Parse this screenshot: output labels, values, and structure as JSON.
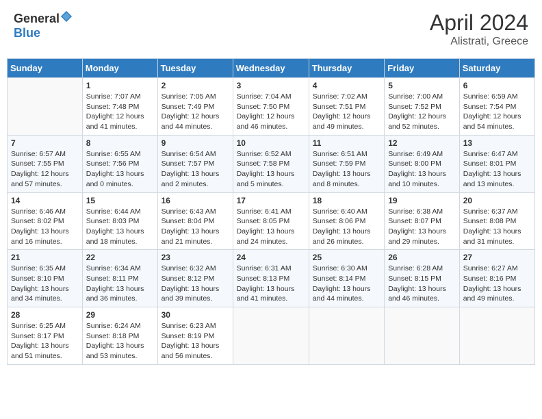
{
  "header": {
    "logo_general": "General",
    "logo_blue": "Blue",
    "month": "April 2024",
    "location": "Alistrati, Greece"
  },
  "days_of_week": [
    "Sunday",
    "Monday",
    "Tuesday",
    "Wednesday",
    "Thursday",
    "Friday",
    "Saturday"
  ],
  "weeks": [
    [
      {
        "day": "",
        "info": ""
      },
      {
        "day": "1",
        "info": "Sunrise: 7:07 AM\nSunset: 7:48 PM\nDaylight: 12 hours\nand 41 minutes."
      },
      {
        "day": "2",
        "info": "Sunrise: 7:05 AM\nSunset: 7:49 PM\nDaylight: 12 hours\nand 44 minutes."
      },
      {
        "day": "3",
        "info": "Sunrise: 7:04 AM\nSunset: 7:50 PM\nDaylight: 12 hours\nand 46 minutes."
      },
      {
        "day": "4",
        "info": "Sunrise: 7:02 AM\nSunset: 7:51 PM\nDaylight: 12 hours\nand 49 minutes."
      },
      {
        "day": "5",
        "info": "Sunrise: 7:00 AM\nSunset: 7:52 PM\nDaylight: 12 hours\nand 52 minutes."
      },
      {
        "day": "6",
        "info": "Sunrise: 6:59 AM\nSunset: 7:54 PM\nDaylight: 12 hours\nand 54 minutes."
      }
    ],
    [
      {
        "day": "7",
        "info": "Sunrise: 6:57 AM\nSunset: 7:55 PM\nDaylight: 12 hours\nand 57 minutes."
      },
      {
        "day": "8",
        "info": "Sunrise: 6:55 AM\nSunset: 7:56 PM\nDaylight: 13 hours\nand 0 minutes."
      },
      {
        "day": "9",
        "info": "Sunrise: 6:54 AM\nSunset: 7:57 PM\nDaylight: 13 hours\nand 2 minutes."
      },
      {
        "day": "10",
        "info": "Sunrise: 6:52 AM\nSunset: 7:58 PM\nDaylight: 13 hours\nand 5 minutes."
      },
      {
        "day": "11",
        "info": "Sunrise: 6:51 AM\nSunset: 7:59 PM\nDaylight: 13 hours\nand 8 minutes."
      },
      {
        "day": "12",
        "info": "Sunrise: 6:49 AM\nSunset: 8:00 PM\nDaylight: 13 hours\nand 10 minutes."
      },
      {
        "day": "13",
        "info": "Sunrise: 6:47 AM\nSunset: 8:01 PM\nDaylight: 13 hours\nand 13 minutes."
      }
    ],
    [
      {
        "day": "14",
        "info": "Sunrise: 6:46 AM\nSunset: 8:02 PM\nDaylight: 13 hours\nand 16 minutes."
      },
      {
        "day": "15",
        "info": "Sunrise: 6:44 AM\nSunset: 8:03 PM\nDaylight: 13 hours\nand 18 minutes."
      },
      {
        "day": "16",
        "info": "Sunrise: 6:43 AM\nSunset: 8:04 PM\nDaylight: 13 hours\nand 21 minutes."
      },
      {
        "day": "17",
        "info": "Sunrise: 6:41 AM\nSunset: 8:05 PM\nDaylight: 13 hours\nand 24 minutes."
      },
      {
        "day": "18",
        "info": "Sunrise: 6:40 AM\nSunset: 8:06 PM\nDaylight: 13 hours\nand 26 minutes."
      },
      {
        "day": "19",
        "info": "Sunrise: 6:38 AM\nSunset: 8:07 PM\nDaylight: 13 hours\nand 29 minutes."
      },
      {
        "day": "20",
        "info": "Sunrise: 6:37 AM\nSunset: 8:08 PM\nDaylight: 13 hours\nand 31 minutes."
      }
    ],
    [
      {
        "day": "21",
        "info": "Sunrise: 6:35 AM\nSunset: 8:10 PM\nDaylight: 13 hours\nand 34 minutes."
      },
      {
        "day": "22",
        "info": "Sunrise: 6:34 AM\nSunset: 8:11 PM\nDaylight: 13 hours\nand 36 minutes."
      },
      {
        "day": "23",
        "info": "Sunrise: 6:32 AM\nSunset: 8:12 PM\nDaylight: 13 hours\nand 39 minutes."
      },
      {
        "day": "24",
        "info": "Sunrise: 6:31 AM\nSunset: 8:13 PM\nDaylight: 13 hours\nand 41 minutes."
      },
      {
        "day": "25",
        "info": "Sunrise: 6:30 AM\nSunset: 8:14 PM\nDaylight: 13 hours\nand 44 minutes."
      },
      {
        "day": "26",
        "info": "Sunrise: 6:28 AM\nSunset: 8:15 PM\nDaylight: 13 hours\nand 46 minutes."
      },
      {
        "day": "27",
        "info": "Sunrise: 6:27 AM\nSunset: 8:16 PM\nDaylight: 13 hours\nand 49 minutes."
      }
    ],
    [
      {
        "day": "28",
        "info": "Sunrise: 6:25 AM\nSunset: 8:17 PM\nDaylight: 13 hours\nand 51 minutes."
      },
      {
        "day": "29",
        "info": "Sunrise: 6:24 AM\nSunset: 8:18 PM\nDaylight: 13 hours\nand 53 minutes."
      },
      {
        "day": "30",
        "info": "Sunrise: 6:23 AM\nSunset: 8:19 PM\nDaylight: 13 hours\nand 56 minutes."
      },
      {
        "day": "",
        "info": ""
      },
      {
        "day": "",
        "info": ""
      },
      {
        "day": "",
        "info": ""
      },
      {
        "day": "",
        "info": ""
      }
    ]
  ]
}
